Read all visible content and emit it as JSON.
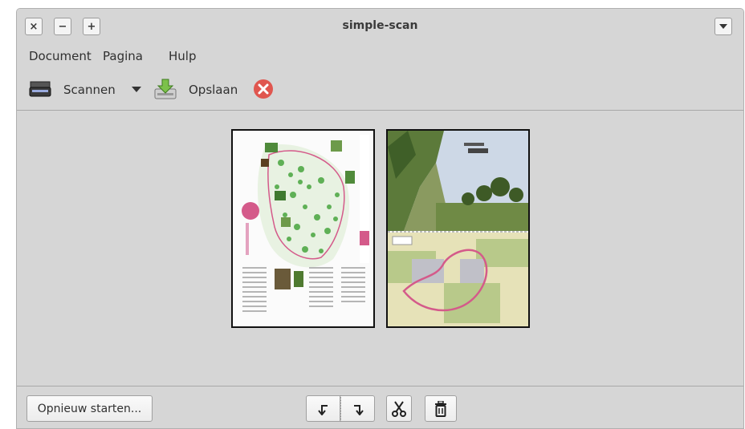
{
  "window": {
    "title": "simple-scan",
    "controls": {
      "close": "×",
      "minimize": "−",
      "maximize": "+"
    }
  },
  "menubar": {
    "items": [
      "Document",
      "Pagina",
      "Hulp"
    ]
  },
  "toolbar": {
    "scan_label": "Scannen",
    "save_label": "Opslaan",
    "icons": {
      "scan": "scanner-icon",
      "dropdown": "dropdown-arrow-icon",
      "save": "save-icon",
      "stop": "stop-icon"
    }
  },
  "pages": [
    {
      "name": "page-1",
      "description_icon": "scanned-page-thumbnail"
    },
    {
      "name": "page-2",
      "description_icon": "scanned-page-thumbnail"
    }
  ],
  "bottom": {
    "restart_label": "Opnieuw starten...",
    "icons": [
      "rotate-left-icon",
      "rotate-right-icon",
      "crop-icon",
      "delete-icon"
    ]
  },
  "colors": {
    "window_bg": "#d6d6d6",
    "stop_red": "#e0564f",
    "map_green": "#5fb056",
    "route_pink": "#d45a8a"
  }
}
